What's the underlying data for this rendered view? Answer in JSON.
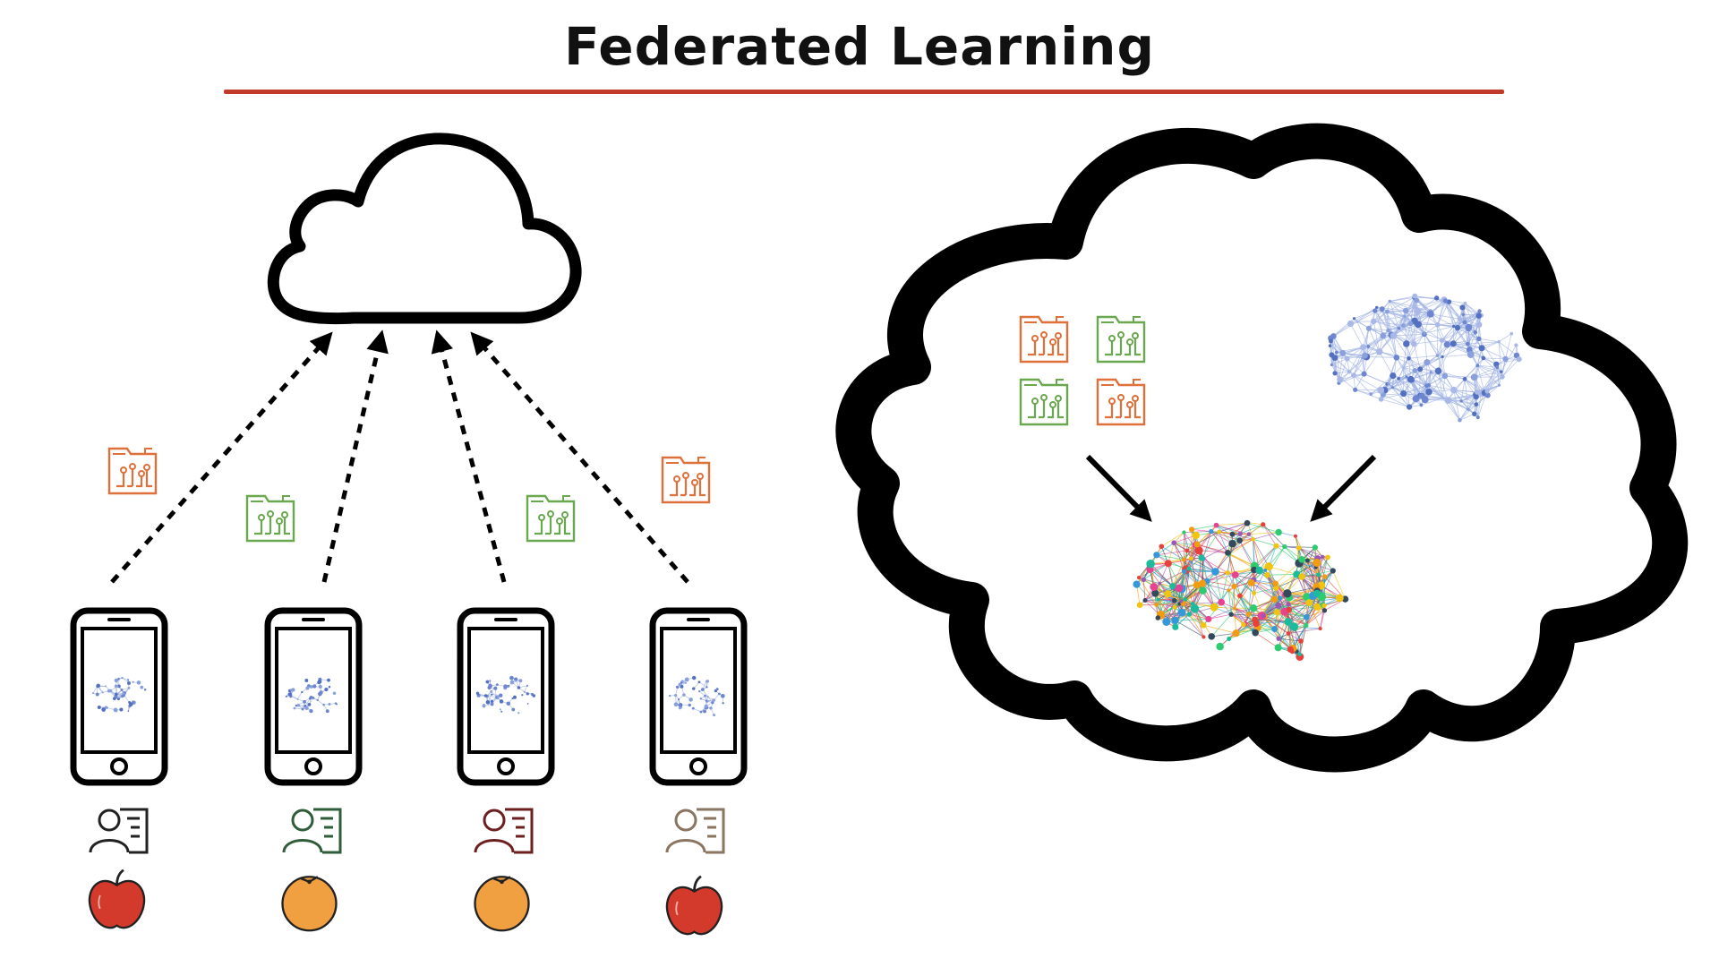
{
  "title": "Federated Learning",
  "colors": {
    "rule": "#c0392b",
    "stroke": "#000000",
    "update_orange": "#e0703a",
    "update_green": "#6aa84f",
    "brain_blue": "#6d86cf",
    "apple": "#d33a2c",
    "orange_fruit": "#f0a040"
  },
  "clients": [
    {
      "person_color": "#222222",
      "fruit": "apple",
      "update_color": "orange"
    },
    {
      "person_color": "#2f5d3a",
      "fruit": "orange",
      "update_color": "green"
    },
    {
      "person_color": "#6b1f1f",
      "fruit": "orange",
      "update_color": "green"
    },
    {
      "person_color": "#8a7560",
      "fruit": "apple",
      "update_color": "orange"
    }
  ],
  "icons": [
    "cloud-icon",
    "phone-icon",
    "brain-icon",
    "person-card-icon",
    "apple-icon",
    "orange-icon",
    "model-update-icon",
    "arrow-icon"
  ]
}
